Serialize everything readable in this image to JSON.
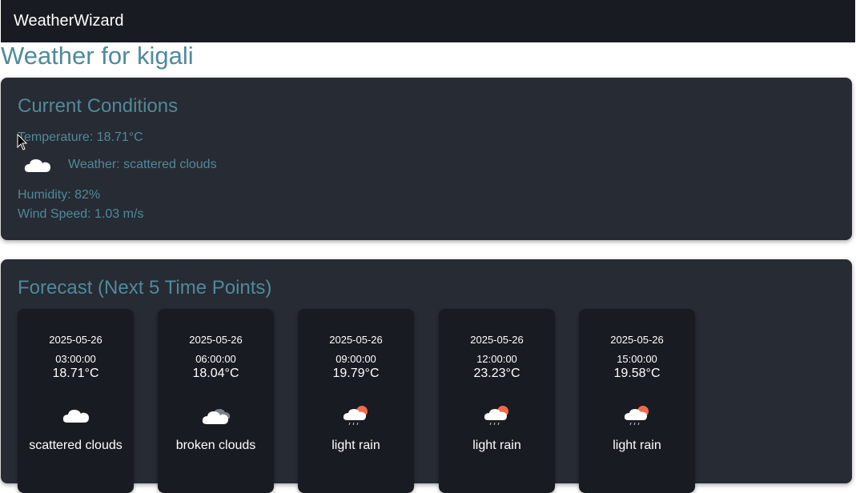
{
  "navbar": {
    "brand": "WeatherWizard"
  },
  "page_title": "Weather for kigali",
  "current": {
    "title": "Current Conditions",
    "temperature": "Temperature: 18.71°C",
    "weather": "Weather: scattered clouds",
    "weather_icon": "cloud-icon",
    "humidity": "Humidity: 82%",
    "wind": "Wind Speed: 1.03 m/s"
  },
  "forecast": {
    "title": "Forecast (Next 5 Time Points)",
    "items": [
      {
        "date": "2025-05-26 03:00:00",
        "temp": "18.71°C",
        "desc": "scattered clouds",
        "icon": "cloud-icon"
      },
      {
        "date": "2025-05-26 06:00:00",
        "temp": "18.04°C",
        "desc": "broken clouds",
        "icon": "broken-clouds-icon"
      },
      {
        "date": "2025-05-26 09:00:00",
        "temp": "19.79°C",
        "desc": "light rain",
        "icon": "rain-sun-icon"
      },
      {
        "date": "2025-05-26 12:00:00",
        "temp": "23.23°C",
        "desc": "light rain",
        "icon": "rain-sun-icon"
      },
      {
        "date": "2025-05-26 15:00:00",
        "temp": "19.58°C",
        "desc": "light rain",
        "icon": "rain-sun-icon"
      }
    ]
  },
  "colors": {
    "navbar_bg": "#181b22",
    "card_bg": "#272b33",
    "accent_text": "#4f8a9b"
  }
}
